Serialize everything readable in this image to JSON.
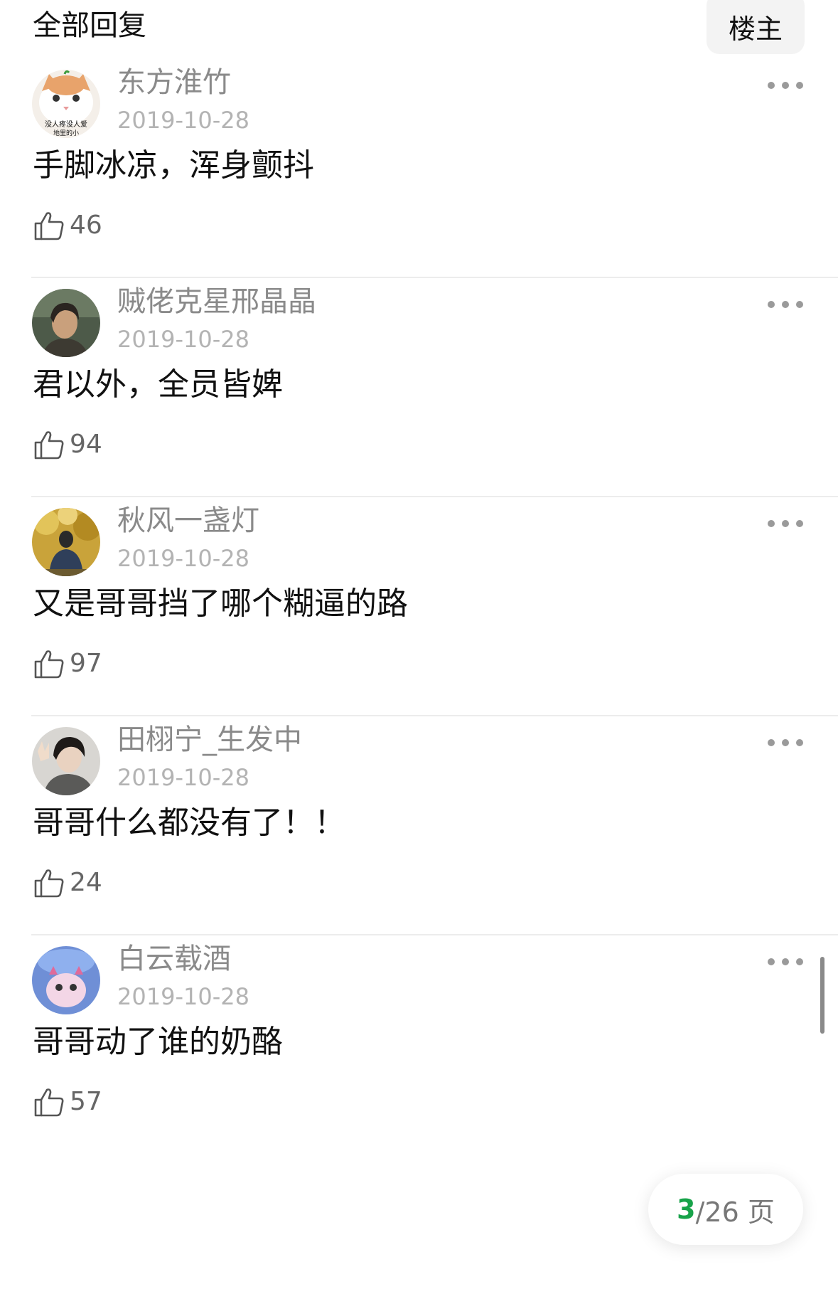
{
  "header": {
    "title": "全部回复",
    "owner_button": "楼主"
  },
  "replies": [
    {
      "username": "东方淮竹",
      "date": "2019-10-28",
      "content": "手脚冰凉，浑身颤抖",
      "likes": "46",
      "avatar_caption_1": "没人疼没人爱",
      "avatar_caption_2": "地里的小"
    },
    {
      "username": "贼佬克星邢晶晶",
      "date": "2019-10-28",
      "content": "君以外，全员皆婢",
      "likes": "94"
    },
    {
      "username": "秋风一盏灯",
      "date": "2019-10-28",
      "content": "又是哥哥挡了哪个糊逼的路",
      "likes": "97"
    },
    {
      "username": "田栩宁_生发中",
      "date": "2019-10-28",
      "content": "哥哥什么都没有了！！",
      "likes": "24"
    },
    {
      "username": "白云载酒",
      "date": "2019-10-28",
      "content": "哥哥动了谁的奶酪",
      "likes": "57"
    }
  ],
  "pager": {
    "current": "3",
    "total": "/26 页"
  },
  "colors": {
    "accent": "#18a34a",
    "username": "#8a8a8a",
    "date": "#b3b3b3"
  },
  "icons": {
    "like": "thumbs-up-icon",
    "more": "more-dots-icon"
  }
}
